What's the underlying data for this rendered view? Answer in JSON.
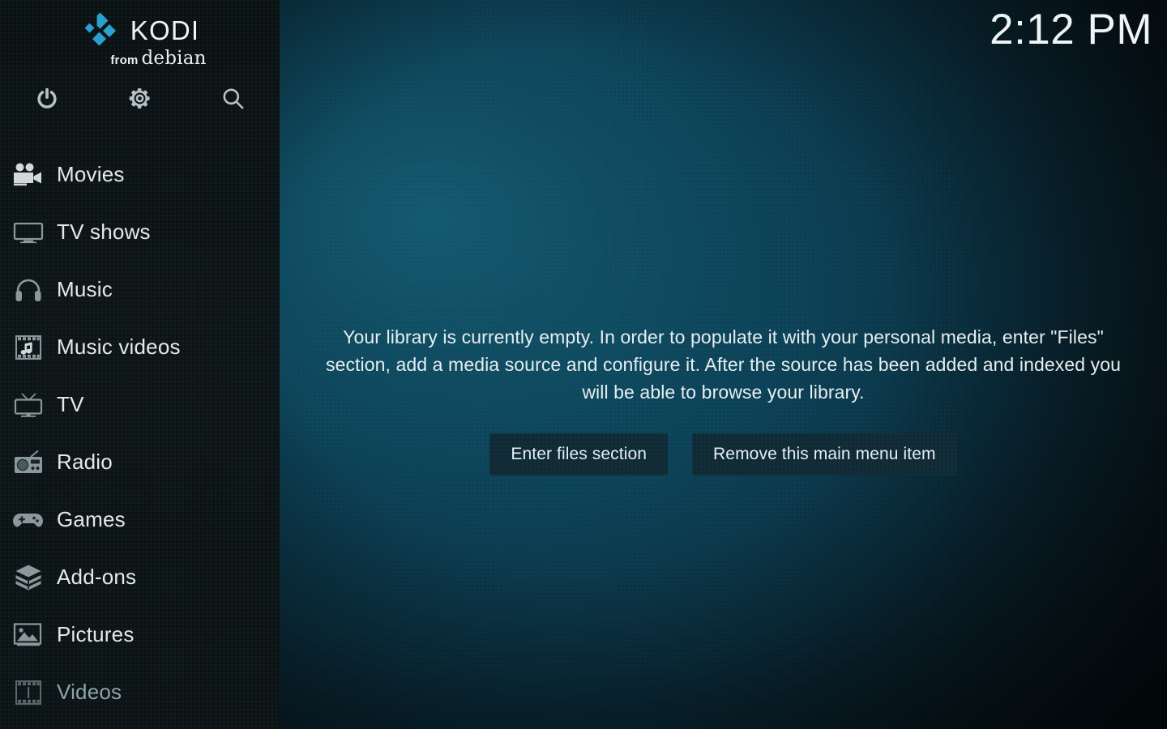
{
  "app": {
    "name": "Kodi",
    "logo_word": "KODI",
    "logo_from": "from",
    "logo_distro": "debian",
    "accent_color": "#22a0d4"
  },
  "clock": {
    "time": "2:12 PM"
  },
  "toolbar": {
    "buttons": [
      {
        "name": "power-icon",
        "label": "Power"
      },
      {
        "name": "gear-icon",
        "label": "Settings"
      },
      {
        "name": "search-icon",
        "label": "Search"
      }
    ]
  },
  "sidebar": {
    "items": [
      {
        "label": "Movies",
        "icon": "movie-camera-icon",
        "dim": false
      },
      {
        "label": "TV shows",
        "icon": "tv-monitor-icon",
        "dim": false
      },
      {
        "label": "Music",
        "icon": "headphones-icon",
        "dim": false
      },
      {
        "label": "Music videos",
        "icon": "film-music-icon",
        "dim": false
      },
      {
        "label": "TV",
        "icon": "retro-tv-icon",
        "dim": false
      },
      {
        "label": "Radio",
        "icon": "radio-icon",
        "dim": false
      },
      {
        "label": "Games",
        "icon": "gamepad-icon",
        "dim": false
      },
      {
        "label": "Add-ons",
        "icon": "open-box-icon",
        "dim": false
      },
      {
        "label": "Pictures",
        "icon": "picture-icon",
        "dim": false
      },
      {
        "label": "Videos",
        "icon": "film-strip-icon",
        "dim": true
      }
    ]
  },
  "main": {
    "empty_message": "Your library is currently empty. In order to populate it with your personal media, enter \"Files\" section, add a media source and configure it. After the source has been added and indexed you will be able to browse your library.",
    "primary_button": "Enter files section",
    "secondary_button": "Remove this main menu item"
  },
  "colors": {
    "sidebar_bg": "#0d1517",
    "main_bg_center": "#0e5068",
    "main_bg_edge": "#060f13",
    "button_bg": "#102b36",
    "text": "#e7eef0",
    "text_dim": "#8ea3aa"
  }
}
